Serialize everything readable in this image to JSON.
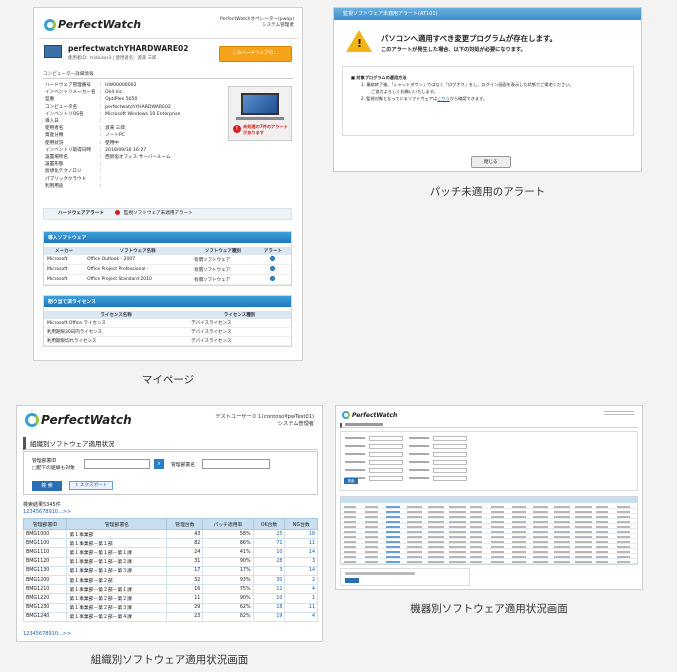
{
  "mypage": {
    "logo_text": "PerfectWatch",
    "header_user": "PerfectWatchオペレーター(pwop)",
    "header_role": "システム管理者",
    "device_title": "perfectwatchYHARDWARE02",
    "device_sub": "使用者ID：trialuser3 | 使用者名：渡来 三郎",
    "my_button": "このハードウェアの…",
    "section_detail": "コンピューター詳細情報",
    "details": [
      {
        "k": "ハードウェア管理番号",
        "v": "HW00000002"
      },
      {
        "k": "インベントリメーカー名",
        "v": "Dell Inc."
      },
      {
        "k": "型番",
        "v": "OptiPlex 5050"
      },
      {
        "k": "コンピュータ名",
        "v": "perfectwatchYHARDWARE02"
      },
      {
        "k": "インベントリOS名",
        "v": "Microsoft Windows 10 Enterprise"
      },
      {
        "k": "導入日",
        "v": ""
      },
      {
        "k": "使用者名",
        "v": "渡来 三郎"
      },
      {
        "k": "資産分類",
        "v": "ノートPC"
      },
      {
        "k": "使用状況",
        "v": "使用中"
      },
      {
        "k": "インベントリ取得日時",
        "v": "2018/09/30 16:27"
      },
      {
        "k": "設置場所名",
        "v": "西新宿オフィス:サーバールーム"
      },
      {
        "k": "設置形態",
        "v": ""
      },
      {
        "k": "仮想化テクノロジ",
        "v": ""
      },
      {
        "k": "パブリッククラウド",
        "v": ""
      },
      {
        "k": "利用用途",
        "v": ""
      }
    ],
    "pc_alert": "未処理の7件のアラートがあります",
    "alert_label": "ハードウェアアラート",
    "alert_value": "監視ソフトウェア未適用アラート",
    "sw_section": "導入ソフトウェア",
    "sw_headers": [
      "メーカー",
      "ソフトウェア名称",
      "ソフトウェア種別",
      "アラート"
    ],
    "sw_rows": [
      [
        "Microsoft",
        "Office Outlook - 2007",
        "有償ソフトウェア"
      ],
      [
        "Microsoft",
        "Office Project Professional -",
        "有償ソフトウェア"
      ],
      [
        "Microsoft",
        "Office Project Standard 2010",
        "有償ソフトウェア"
      ]
    ],
    "lic_section": "割り当て済ライセンス",
    "lic_headers": [
      "ライセンス名称",
      "ライセンス種別"
    ],
    "lic_rows": [
      [
        "Microsoft Office ライセンス",
        "デバイスライセンス"
      ],
      [
        "利用期限30日内ライセンス",
        "デバイスライセンス"
      ],
      [
        "利用期限切れライセンス",
        "デバイスライセンス"
      ]
    ]
  },
  "caption_mypage": "マイページ",
  "alert": {
    "titlebar": "監視ソフトウェア未適用アラート(AT101)",
    "heading": "パソコンへ適用すべき変更プログラムが存在します。",
    "sub": "このアラートが発生した場合、以下の対処が必要になります。",
    "method_title": "■ 対象プログラムの適用方法",
    "line1": "1. 業務終了後、「シャットダウン」ではなく「ログオフ」をし、ログイン画面を表示した状態でご帰宅ください。",
    "line1b": "ご協力よろしくお願いいたします。",
    "line2a": "2. 監視対象となっているソフトウェアは",
    "line2link": "こちら",
    "line2b": "から確認できます。",
    "close": "閉じる"
  },
  "caption_alert": "パッチ未適用のアラート",
  "org": {
    "logo_text": "PerfectWatch",
    "user": "テストユーザー０１(contoso¥pwTest01)",
    "role": "システム管理者",
    "page_title": "組織別ソフトウェア適用状況",
    "field1": "管理部署ID",
    "field1b": "□配下の組織も対象",
    "field2": "管理部署名",
    "search_btn": "検 索",
    "export_btn": "エクスポート",
    "result_count": "検索結果5345件",
    "pager": "12345678910...>>",
    "headers": [
      "管理部署ID",
      "管理部署名",
      "管理台数",
      "パッチ適用率",
      "OK台数",
      "NG台数"
    ],
    "rows": [
      [
        "BMG1000",
        "第１事業部",
        "43",
        "58%",
        "25",
        "18"
      ],
      [
        "BMG1100",
        "第１事業部－第１部",
        "82",
        "86%",
        "71",
        "11"
      ],
      [
        "BMG1110",
        "第１事業部－第１部－第１課",
        "24",
        "41%",
        "10",
        "14"
      ],
      [
        "BMG1120",
        "第１事業部－第１部－第２課",
        "31",
        "90%",
        "28",
        "3"
      ],
      [
        "BMG1130",
        "第１事業部－第１部－第３課",
        "17",
        "17%",
        "3",
        "14"
      ],
      [
        "BMG1200",
        "第１事業部－第２部",
        "32",
        "93%",
        "30",
        "2"
      ],
      [
        "BMG1210",
        "第１事業部－第２部－第１課",
        "16",
        "75%",
        "12",
        "4"
      ],
      [
        "BMG1220",
        "第１事業部－第２部－第２課",
        "11",
        "90%",
        "10",
        "1"
      ],
      [
        "BMG1230",
        "第１事業部－第２部－第３課",
        "29",
        "62%",
        "18",
        "11"
      ],
      [
        "BMG1240",
        "第１事業部－第２部－第４課",
        "23",
        "82%",
        "19",
        "4"
      ]
    ],
    "pager_bottom": "12345678910...>>"
  },
  "caption_org": "組織別ソフトウェア適用状況画面",
  "device": {
    "logo_text": "PerfectWatch",
    "page_title": "機器別ソフトウェア適用状況画面",
    "search_btn": "検索"
  },
  "caption_device": "機器別ソフトウェア適用状況画面"
}
